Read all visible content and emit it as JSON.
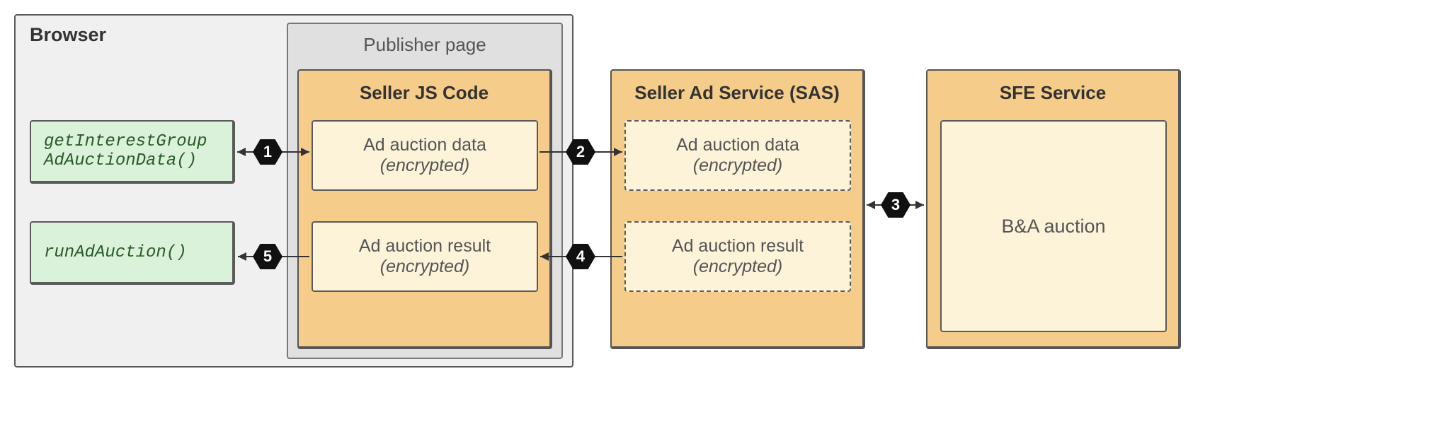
{
  "browser": {
    "label": "Browser"
  },
  "publisher": {
    "label": "Publisher page"
  },
  "sellerJs": {
    "title": "Seller JS Code"
  },
  "api": {
    "getIG": "getInterestGroup AdAuctionData()",
    "runAuction": "runAdAuction()"
  },
  "boxes": {
    "data_label": "Ad auction data",
    "result_label": "Ad auction result",
    "encrypted": "(encrypted)"
  },
  "sas": {
    "title": "Seller Ad Service (SAS)"
  },
  "sfe": {
    "title": "SFE Service",
    "ba": "B&A auction"
  },
  "steps": {
    "s1": "1",
    "s2": "2",
    "s3": "3",
    "s4": "4",
    "s5": "5"
  }
}
